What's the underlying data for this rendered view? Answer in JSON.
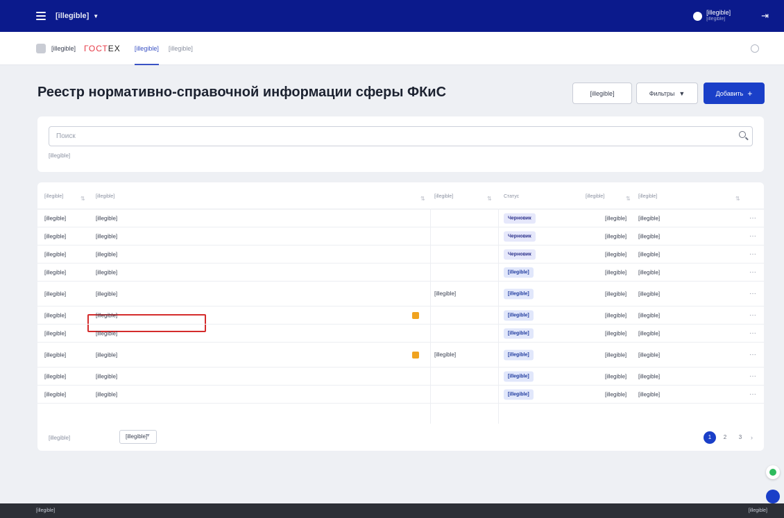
{
  "topbar": {
    "app_title": "[illegible]",
    "user_name": "[illegible]",
    "user_role": "[illegible]"
  },
  "navbar": {
    "org": "[illegible]",
    "brand_a": "ГОСТ",
    "brand_b": "ЕХ",
    "tabs": [
      "[illegible]",
      "[illegible]"
    ]
  },
  "page": {
    "title": "Реестр нормативно-справочной информации сферы ФКиС"
  },
  "actions": {
    "unsubscribe": "[illegible]",
    "filters": "Фильтры",
    "add": "Добавить"
  },
  "search": {
    "placeholder": "Поиск",
    "count": "[illegible]"
  },
  "columns": [
    "[illegible]",
    "[illegible]",
    "[illegible]",
    "Статус",
    "[illegible]",
    "[illegible]"
  ],
  "rows": [
    {
      "code": "[illegible]",
      "name": "[illegible]",
      "category": "",
      "status": "Черновик",
      "status_type": "draft",
      "version": "[illegible]",
      "date": "[illegible]",
      "lock": false,
      "highlight": false
    },
    {
      "code": "[illegible]",
      "name": "[illegible]",
      "category": "",
      "status": "Черновик",
      "status_type": "draft",
      "version": "[illegible]",
      "date": "[illegible]",
      "lock": false,
      "highlight": false
    },
    {
      "code": "[illegible]",
      "name": "[illegible]",
      "category": "",
      "status": "Черновик",
      "status_type": "draft",
      "version": "[illegible]",
      "date": "[illegible]",
      "lock": false,
      "highlight": false
    },
    {
      "code": "[illegible]",
      "name": "[illegible]",
      "category": "",
      "status": "[illegible]",
      "status_type": "approved",
      "version": "[illegible]",
      "date": "[illegible]",
      "lock": false,
      "highlight": false
    },
    {
      "code": "[illegible]",
      "name": "[illegible]",
      "category": "[illegible]",
      "status": "[illegible]",
      "status_type": "approved",
      "version": "[illegible]",
      "date": "[illegible]",
      "lock": false,
      "highlight": false
    },
    {
      "code": "[illegible]",
      "name": "[illegible]",
      "category": "",
      "status": "[illegible]",
      "status_type": "approved",
      "version": "[illegible]",
      "date": "[illegible]",
      "lock": true,
      "highlight": true
    },
    {
      "code": "[illegible]",
      "name": "[illegible]",
      "category": "",
      "status": "[illegible]",
      "status_type": "approved",
      "version": "[illegible]",
      "date": "[illegible]",
      "lock": false,
      "highlight": false
    },
    {
      "code": "[illegible]",
      "name": "[illegible]",
      "category": "[illegible]",
      "status": "[illegible]",
      "status_type": "approved",
      "version": "[illegible]",
      "date": "[illegible]",
      "lock": true,
      "highlight": false
    },
    {
      "code": "[illegible]",
      "name": "[illegible]",
      "category": "",
      "status": "[illegible]",
      "status_type": "approved",
      "version": "[illegible]",
      "date": "[illegible]",
      "lock": false,
      "highlight": false
    },
    {
      "code": "[illegible]",
      "name": "[illegible]",
      "category": "",
      "status": "[illegible]",
      "status_type": "approved",
      "version": "[illegible]",
      "date": "[illegible]",
      "lock": false,
      "highlight": false
    }
  ],
  "pagination": {
    "per_page_label": "[illegible]",
    "per_page_value": "[illegible]",
    "pages": [
      "1",
      "2",
      "3"
    ],
    "next": "›"
  },
  "footer": {
    "left": "[illegible]",
    "right": "[illegible]"
  },
  "icons": [
    "menu-icon",
    "caret-down-icon",
    "avatar-icon",
    "logout-icon",
    "emblem-icon",
    "help-icon",
    "filter-icon",
    "plus-icon",
    "search-icon",
    "lock-icon",
    "more-dots-icon",
    "chevron-down-icon",
    "chevron-right-icon",
    "status-ok-icon",
    "chat-icon"
  ]
}
